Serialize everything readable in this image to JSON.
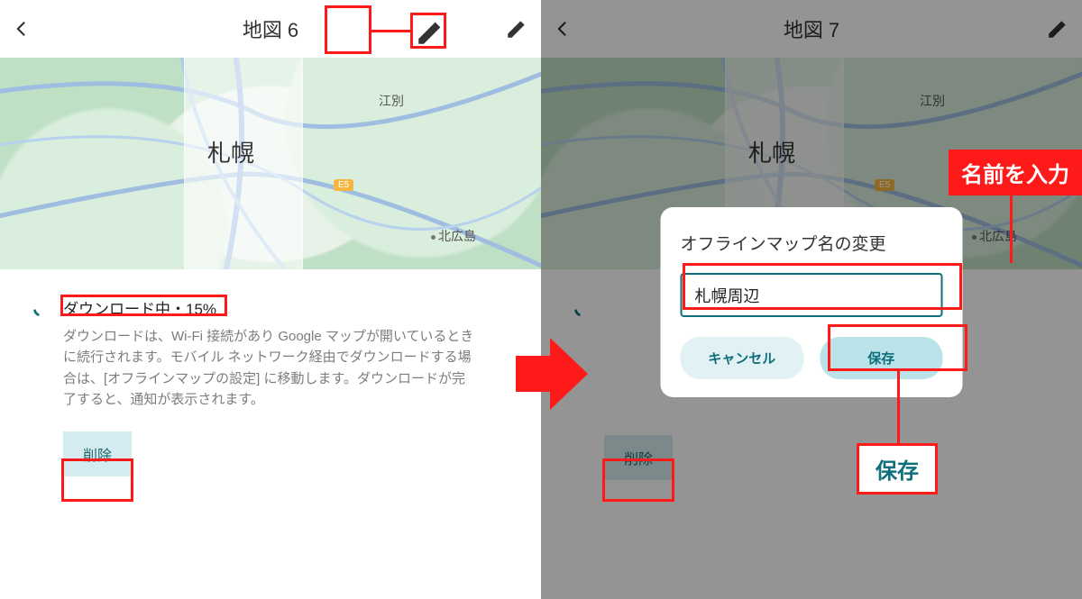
{
  "left": {
    "header": {
      "title": "地図 6"
    },
    "map": {
      "city_label": "札幌",
      "ebetsu_label": "江別",
      "kitahiroshima_label": "北広島",
      "road_badge": "E5"
    },
    "status": {
      "line": "ダウンロード中・15%",
      "description": "ダウンロードは、Wi-Fi 接続があり Google マップが開いているときに続行されます。モバイル ネットワーク経由でダウンロードする場合は、[オフラインマップの設定] に移動します。ダウンロードが完了すると、通知が表示されます。",
      "delete_label": "削除"
    }
  },
  "right": {
    "header": {
      "title": "地図 7"
    },
    "map": {
      "city_label": "札幌",
      "ebetsu_label": "江別",
      "kitahiroshima_label": "北広島",
      "road_badge": "E5"
    },
    "status": {
      "delete_label": "削除"
    },
    "dialog": {
      "title": "オフラインマップ名の変更",
      "value": "札幌周辺",
      "cancel_label": "キャンセル",
      "save_label": "保存"
    }
  },
  "annotations": {
    "name_input_label": "名前を入力",
    "save_callout": "保存"
  }
}
